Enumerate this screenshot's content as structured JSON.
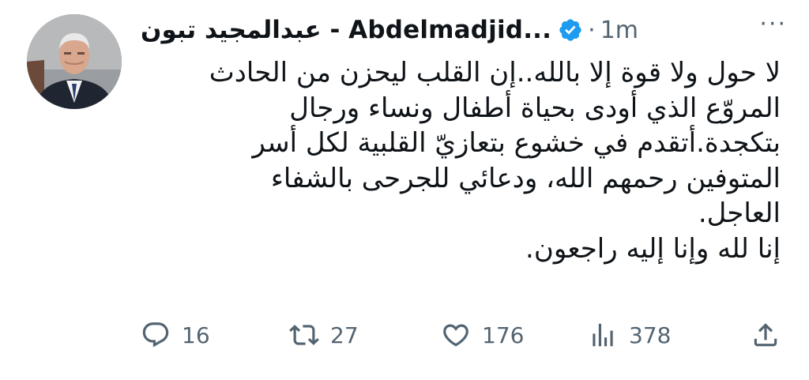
{
  "tweet": {
    "author": {
      "display_name": "عبدالمجيد تبون - Abdelmadjid...",
      "verified": true
    },
    "separator": "·",
    "time": "1m",
    "more_label": "···",
    "body_lines": [
      "لا حول ولا قوة إلا بالله..إن القلب ليحزن من الحادث",
      "المروّع الذي أودى بحياة أطفال ونساء ورجال",
      "بتكجدة.أتقدم في خشوع بتعازيّ القلبية لكل أسر",
      "المتوفين رحمهم الله، ودعائي للجرحى بالشفاء",
      "العاجل.",
      "إنا لله وإنا إليه راجعون."
    ],
    "actions": {
      "replies": "16",
      "retweets": "27",
      "likes": "176",
      "views": "378"
    }
  },
  "colors": {
    "text": "#0f1419",
    "secondary": "#536471",
    "verified_badge": "#1d9bf0"
  },
  "icons": [
    "reply-icon",
    "retweet-icon",
    "like-icon",
    "views-icon",
    "share-icon",
    "verified-badge-icon",
    "more-icon"
  ]
}
